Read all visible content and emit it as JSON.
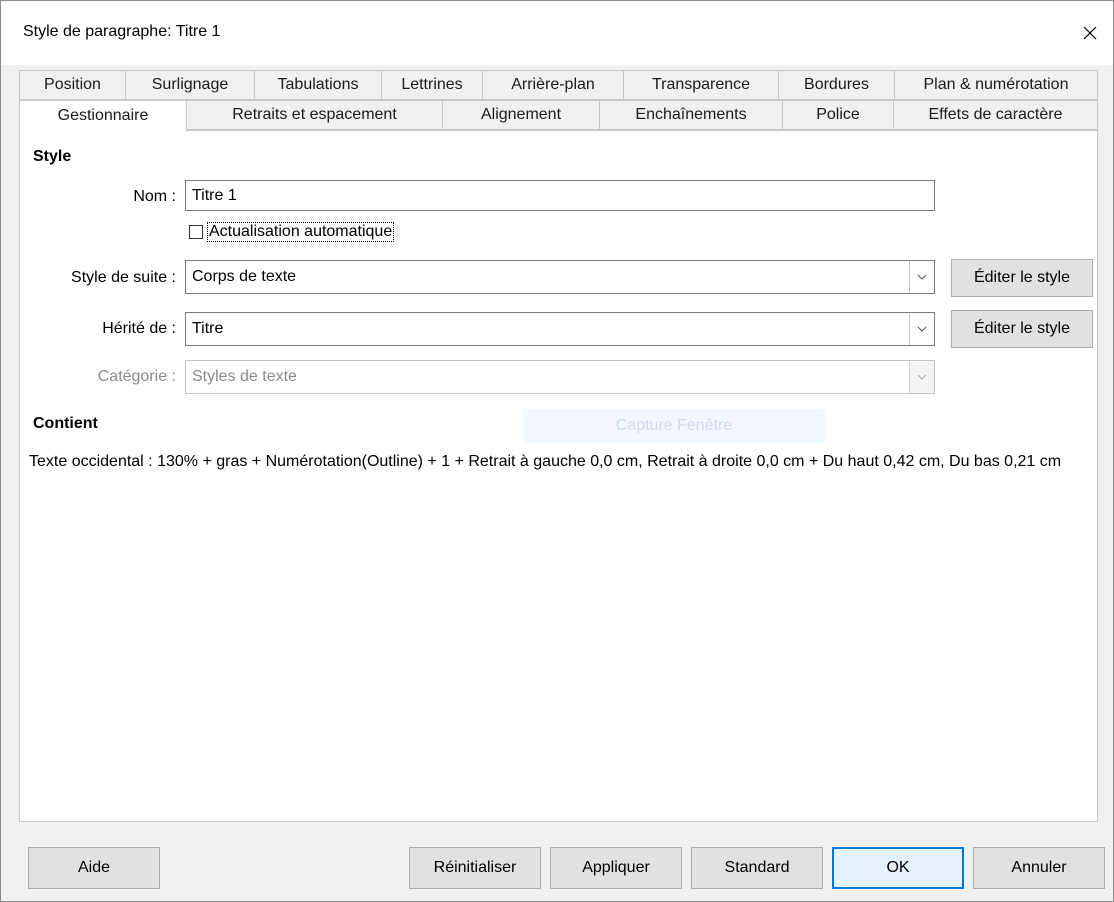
{
  "window": {
    "title": "Style de paragraphe: Titre 1"
  },
  "tabs": {
    "back": [
      "Position",
      "Surlignage",
      "Tabulations",
      "Lettrines",
      "Arrière-plan",
      "Transparence",
      "Bordures",
      "Plan & numérotation"
    ],
    "front": [
      "Gestionnaire",
      "Retraits et espacement",
      "Alignement",
      "Enchaînements",
      "Police",
      "Effets de caractère"
    ],
    "active": "Gestionnaire"
  },
  "style_section": {
    "title": "Style",
    "name_label": "Nom :",
    "name_value": "Titre 1",
    "auto_update_label": "Actualisation automatique",
    "auto_update_checked": false,
    "next_style_label": "Style de suite :",
    "next_style_value": "Corps de texte",
    "inherit_label": "Hérité de :",
    "inherit_value": "Titre",
    "category_label": "Catégorie :",
    "category_value": "Styles de texte",
    "edit_style_label_1": "Éditer le style",
    "edit_style_label_2": "Éditer le style"
  },
  "overlay": {
    "capture_text": "Capture Fenêtre"
  },
  "contains_section": {
    "title": "Contient",
    "description": "Texte occidental : 130% + gras + Numérotation(Outline) + 1 + Retrait à gauche 0,0 cm, Retrait à droite 0,0 cm + Du haut 0,42 cm, Du bas 0,21 cm"
  },
  "footer": {
    "help": "Aide",
    "reset": "Réinitialiser",
    "apply": "Appliquer",
    "standard": "Standard",
    "ok": "OK",
    "cancel": "Annuler"
  }
}
